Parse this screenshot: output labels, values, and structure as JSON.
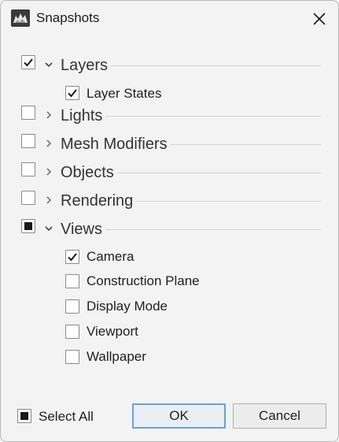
{
  "window": {
    "title": "Snapshots",
    "app_icon": "rhino-icon"
  },
  "groups": [
    {
      "label": "Layers",
      "state": "checked",
      "expanded": true
    },
    {
      "label": "Lights",
      "state": "unchecked",
      "expanded": false
    },
    {
      "label": "Mesh Modifiers",
      "state": "unchecked",
      "expanded": false
    },
    {
      "label": "Objects",
      "state": "unchecked",
      "expanded": false
    },
    {
      "label": "Rendering",
      "state": "unchecked",
      "expanded": false
    },
    {
      "label": "Views",
      "state": "partial",
      "expanded": true
    }
  ],
  "layers_items": [
    {
      "label": "Layer States",
      "checked": true
    }
  ],
  "views_items": [
    {
      "label": "Camera",
      "checked": true
    },
    {
      "label": "Construction Plane",
      "checked": false
    },
    {
      "label": "Display Mode",
      "checked": false
    },
    {
      "label": "Viewport",
      "checked": false
    },
    {
      "label": "Wallpaper",
      "checked": false
    }
  ],
  "footer": {
    "select_all_label": "Select All",
    "select_all_state": "partial",
    "ok_label": "OK",
    "cancel_label": "Cancel"
  },
  "colors": {
    "accent_border": "#6aa0d8",
    "background": "#f3f3f3"
  }
}
